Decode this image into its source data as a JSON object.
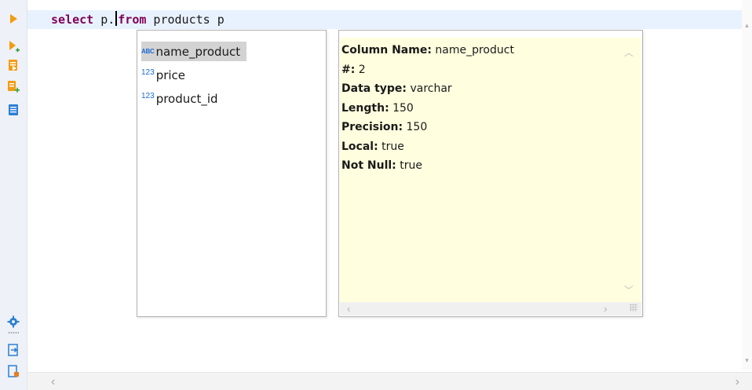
{
  "editor": {
    "sql_keyword_1": "select",
    "sql_before_caret": " p.",
    "sql_keyword_2": "from",
    "sql_after": " products p"
  },
  "toolbar": {
    "buttons": [
      {
        "name": "execute-statement",
        "icon": "play-icon"
      },
      {
        "name": "execute-in-new-tab",
        "icon": "play-plus-icon"
      },
      {
        "name": "execute-script",
        "icon": "script-run-icon"
      },
      {
        "name": "execute-script-new-tab",
        "icon": "script-run-plus-icon"
      },
      {
        "name": "explain-plan",
        "icon": "document-list-icon"
      },
      {
        "name": "settings",
        "icon": "gear-icon"
      },
      {
        "name": "export",
        "icon": "export-icon"
      },
      {
        "name": "load-file",
        "icon": "file-load-icon"
      }
    ]
  },
  "completion": {
    "items": [
      {
        "type_label": "ABC",
        "label": "name_product",
        "selected": true
      },
      {
        "type_label": "123",
        "label": "price",
        "selected": false
      },
      {
        "type_label": "123",
        "label": "product_id",
        "selected": false
      }
    ]
  },
  "info": {
    "lines": [
      {
        "key": "Column Name:",
        "value": " name_product"
      },
      {
        "key": "#:",
        "value": " 2"
      },
      {
        "key": "Data type:",
        "value": " varchar"
      },
      {
        "key": "Length:",
        "value": " 150"
      },
      {
        "key": "Precision:",
        "value": " 150"
      },
      {
        "key": "Local:",
        "value": " true"
      },
      {
        "key": "Not Null:",
        "value": " true"
      }
    ]
  },
  "colors": {
    "keyword": "#7f0055",
    "current_line": "#e8f2fe",
    "info_background": "#ffffdf",
    "type_icon": "#1b6bd2",
    "toolbar_orange": "#f39c12"
  }
}
